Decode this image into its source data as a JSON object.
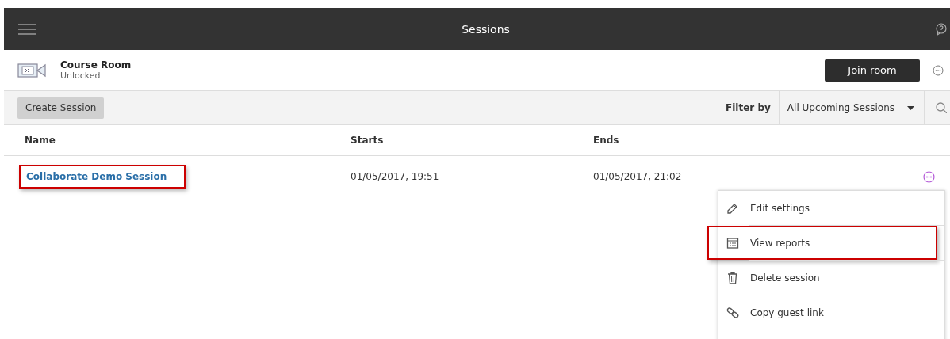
{
  "header": {
    "title": "Sessions"
  },
  "room": {
    "name": "Course Room",
    "status": "Unlocked",
    "join_label": "Join room"
  },
  "toolbar": {
    "create_label": "Create Session",
    "filter_label": "Filter by",
    "filter_value": "All Upcoming Sessions"
  },
  "table": {
    "columns": [
      "Name",
      "Starts",
      "Ends"
    ],
    "rows": [
      {
        "name": "Collaborate Demo Session",
        "starts": "01/05/2017, 19:51",
        "ends": "01/05/2017, 21:02",
        "highlighted": true
      }
    ]
  },
  "menu": {
    "items": [
      {
        "label": "Edit settings",
        "kind": "pencil",
        "highlighted": false
      },
      {
        "label": "View reports",
        "kind": "report",
        "highlighted": true
      },
      {
        "label": "Delete session",
        "kind": "trash",
        "highlighted": false
      },
      {
        "label": "Copy guest link",
        "kind": "link",
        "highlighted": false
      }
    ]
  }
}
